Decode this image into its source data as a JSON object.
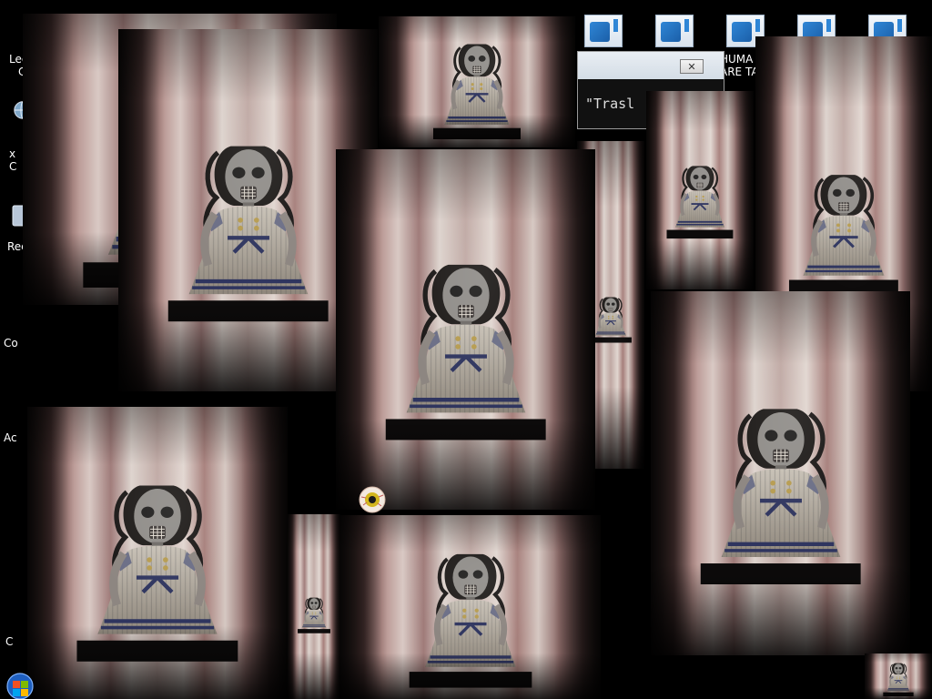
{
  "desktop": {
    "left_icons": [
      {
        "label": "Lee",
        "label2": "C",
        "icon": "app-icon"
      },
      {
        "label": "x",
        "label2": "C",
        "icon": "globe-icon"
      },
      {
        "label": "Rec",
        "label2": "",
        "icon": "recycle-bin-icon"
      },
      {
        "label": "Co",
        "label2": "",
        "icon": ""
      },
      {
        "label": "Ac",
        "label2": "",
        "icon": ""
      },
      {
        "label": "C",
        "label2": "",
        "icon": ""
      }
    ],
    "top_icons": [
      {
        "icon": "document-icon"
      },
      {
        "icon": "document-icon"
      },
      {
        "icon": "document-icon"
      },
      {
        "icon": "document-icon"
      },
      {
        "icon": "document-icon"
      }
    ],
    "top_label_line1": "HUMA",
    "top_label_line2": "ARE TA"
  },
  "dialog": {
    "close_label": "✕",
    "text": "\"Trasl"
  },
  "doll_windows": [
    {
      "name": "doll-window-1"
    },
    {
      "name": "doll-window-2"
    },
    {
      "name": "doll-window-3"
    },
    {
      "name": "doll-window-4"
    },
    {
      "name": "doll-window-5"
    },
    {
      "name": "doll-window-6"
    },
    {
      "name": "doll-window-7"
    },
    {
      "name": "doll-window-8"
    },
    {
      "name": "doll-window-9"
    },
    {
      "name": "doll-window-10"
    },
    {
      "name": "doll-window-11"
    },
    {
      "name": "doll-window-12"
    }
  ],
  "overlay_icon": "eyeball-icon",
  "taskbar": {
    "start_icon": "windows-start-orb-icon"
  }
}
